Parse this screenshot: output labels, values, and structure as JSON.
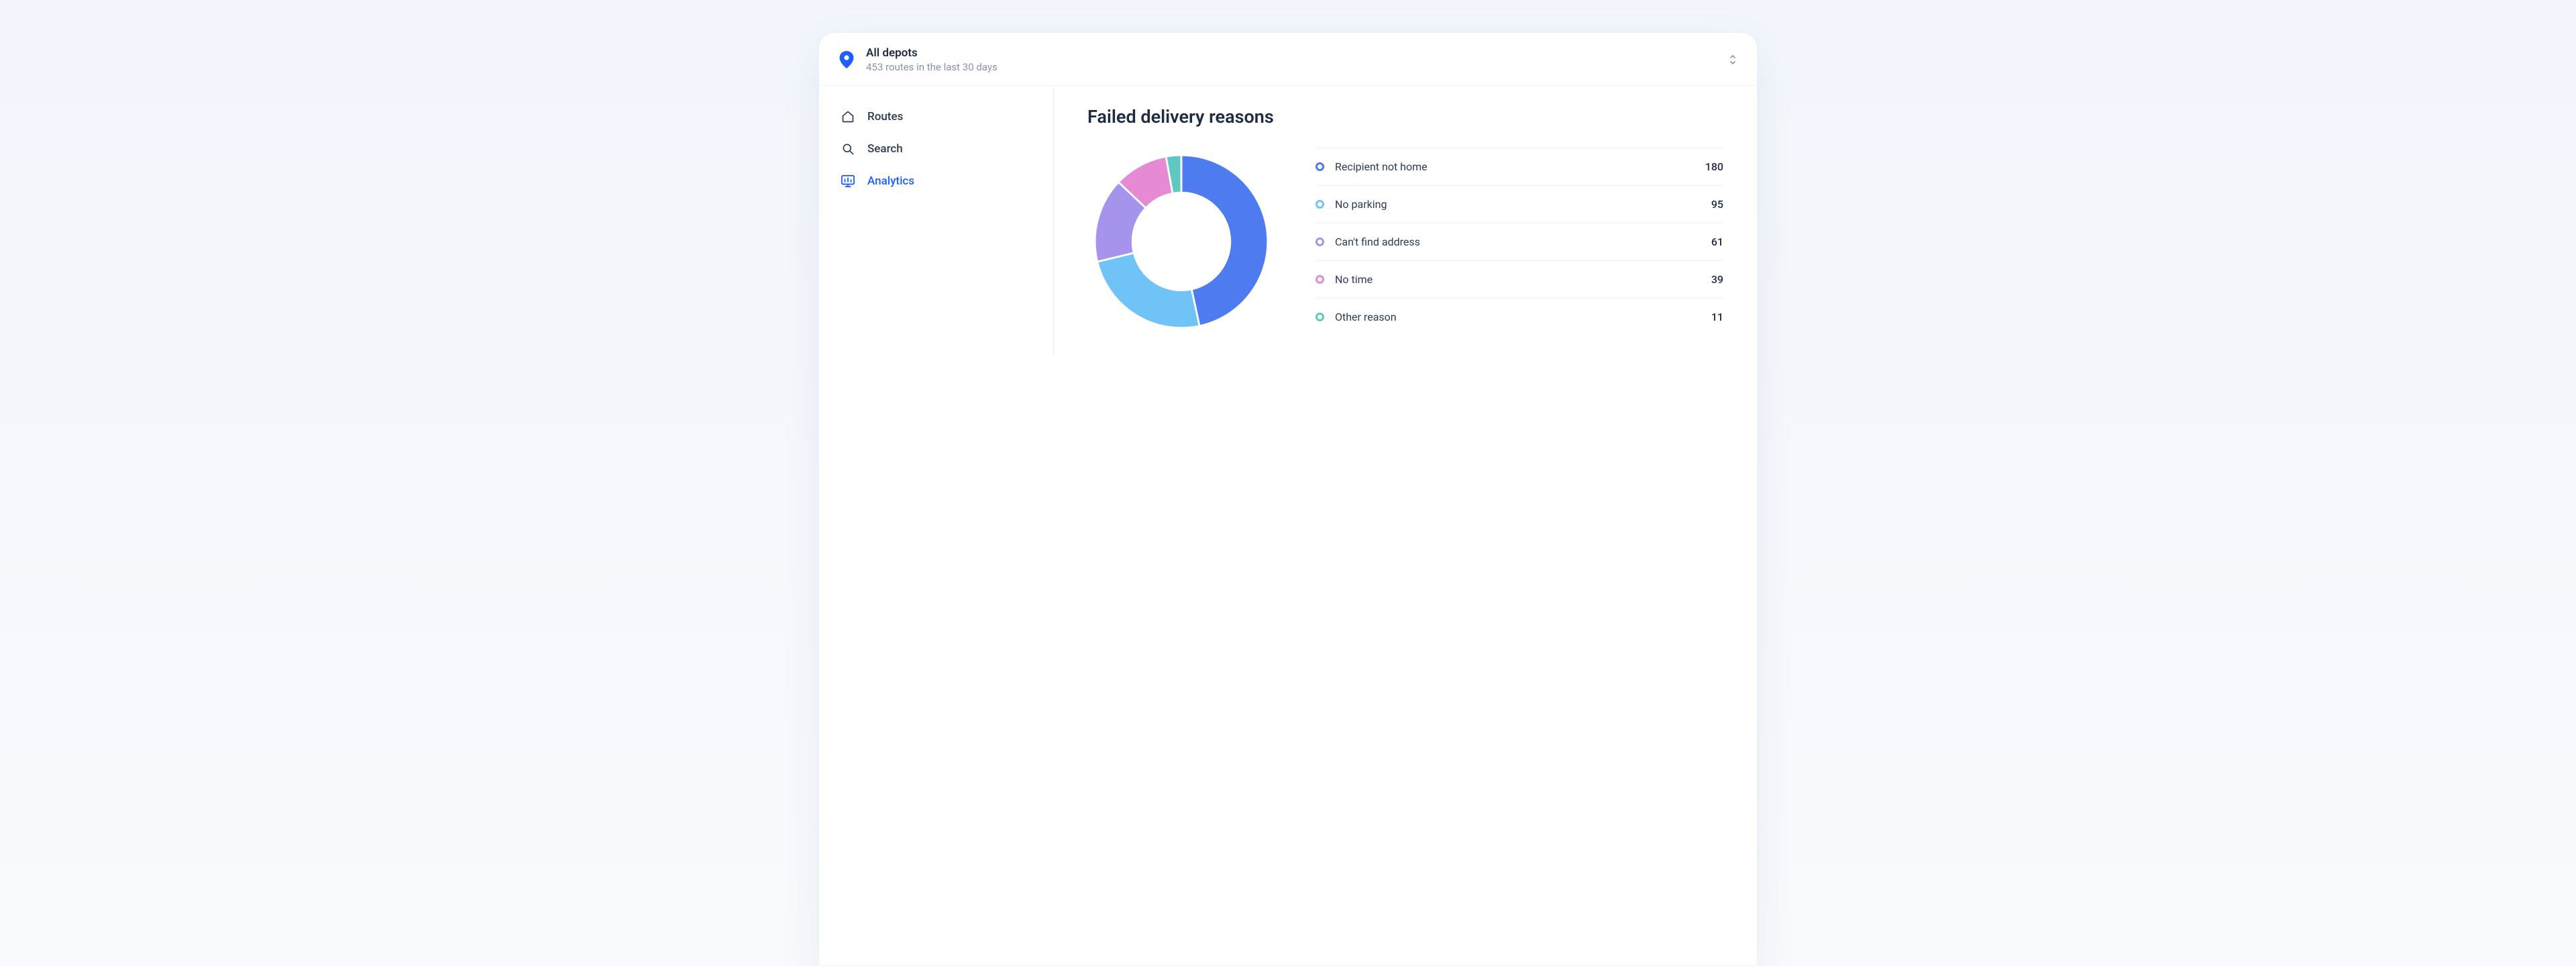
{
  "header": {
    "title": "All depots",
    "subtitle": "453 routes in the last 30 days"
  },
  "sidebar": {
    "items": [
      {
        "label": "Routes",
        "icon": "home-icon",
        "active": false
      },
      {
        "label": "Search",
        "icon": "search-icon",
        "active": false
      },
      {
        "label": "Analytics",
        "icon": "analytics-icon",
        "active": true
      }
    ]
  },
  "main": {
    "title": "Failed delivery reasons"
  },
  "chart_data": {
    "type": "pie",
    "title": "Failed delivery reasons",
    "categories": [
      "Recipient not home",
      "No parking",
      "Can't find address",
      "No time",
      "Other reason"
    ],
    "values": [
      180,
      95,
      61,
      39,
      11
    ],
    "colors": [
      "#4f7bf0",
      "#6fc3f7",
      "#a694ec",
      "#e78ad6",
      "#5fc8c1"
    ]
  }
}
